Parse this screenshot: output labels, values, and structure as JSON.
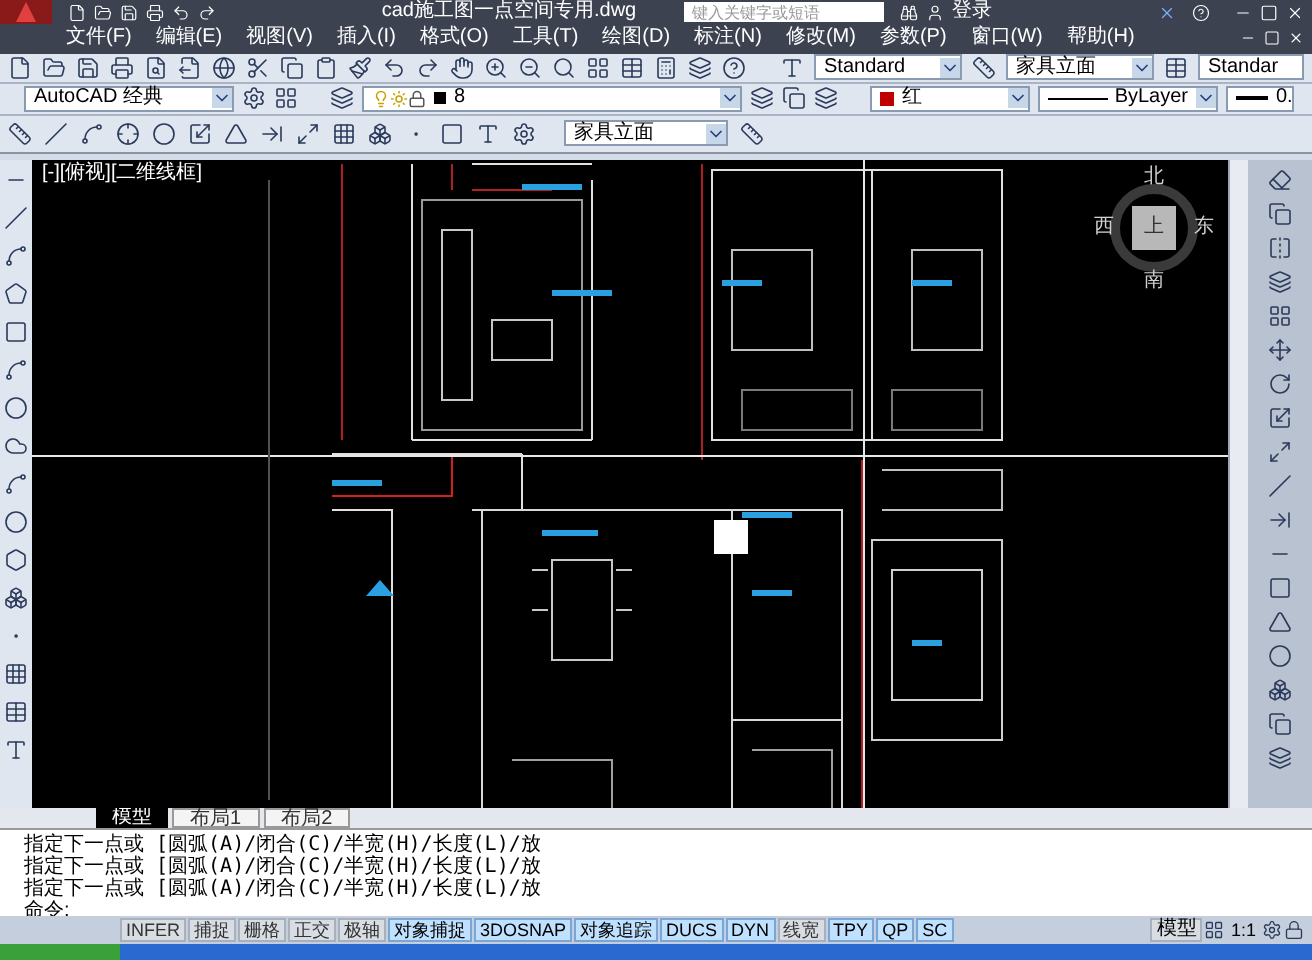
{
  "title_bar": {
    "title": "cad施工图一点空间专用.dwg",
    "search": {
      "placeholder": "键入关键字或短语"
    },
    "user": "登录"
  },
  "menu": [
    "文件(F)",
    "编辑(E)",
    "视图(V)",
    "插入(I)",
    "格式(O)",
    "工具(T)",
    "绘图(D)",
    "标注(N)",
    "修改(M)",
    "参数(P)",
    "窗口(W)",
    "帮助(H)"
  ],
  "toolbar_1": {
    "text_style": "Standard",
    "dim_style": "家具立面",
    "table_style": "Standar"
  },
  "toolbar_2": {
    "workspace": "AutoCAD 经典",
    "layer": "8",
    "color_name": "红",
    "linetype": "ByLayer",
    "lineweight": "0."
  },
  "toolbar_3": {
    "dim_style": "家具立面"
  },
  "viewport": {
    "label": "[-][俯视][二维线框]",
    "viewcube": {
      "north": "北",
      "south": "南",
      "east": "东",
      "west": "西",
      "face": "上"
    }
  },
  "layout_tabs": [
    {
      "label": "模型",
      "selected": true
    },
    {
      "label": "布局1",
      "selected": false
    },
    {
      "label": "布局2",
      "selected": false
    }
  ],
  "command_history": [
    "指定下一点或 [圆弧(A)/闭合(C)/半宽(H)/长度(L)/放",
    "指定下一点或 [圆弧(A)/闭合(C)/半宽(H)/长度(L)/放",
    "指定下一点或 [圆弧(A)/闭合(C)/半宽(H)/长度(L)/放"
  ],
  "command_prompt": "命令:",
  "status_toggles": [
    {
      "label": "INFER",
      "on": false
    },
    {
      "label": "捕捉",
      "on": false
    },
    {
      "label": "栅格",
      "on": false
    },
    {
      "label": "正交",
      "on": false
    },
    {
      "label": "极轴",
      "on": false
    },
    {
      "label": "对象捕捉",
      "on": true
    },
    {
      "label": "3DOSNAP",
      "on": true
    },
    {
      "label": "对象追踪",
      "on": true
    },
    {
      "label": "DUCS",
      "on": true
    },
    {
      "label": "DYN",
      "on": true
    },
    {
      "label": "线宽",
      "on": false
    },
    {
      "label": "TPY",
      "on": true
    },
    {
      "label": "QP",
      "on": true
    },
    {
      "label": "SC",
      "on": true
    }
  ],
  "status_right": {
    "space": "模型",
    "scale": "1:1"
  }
}
